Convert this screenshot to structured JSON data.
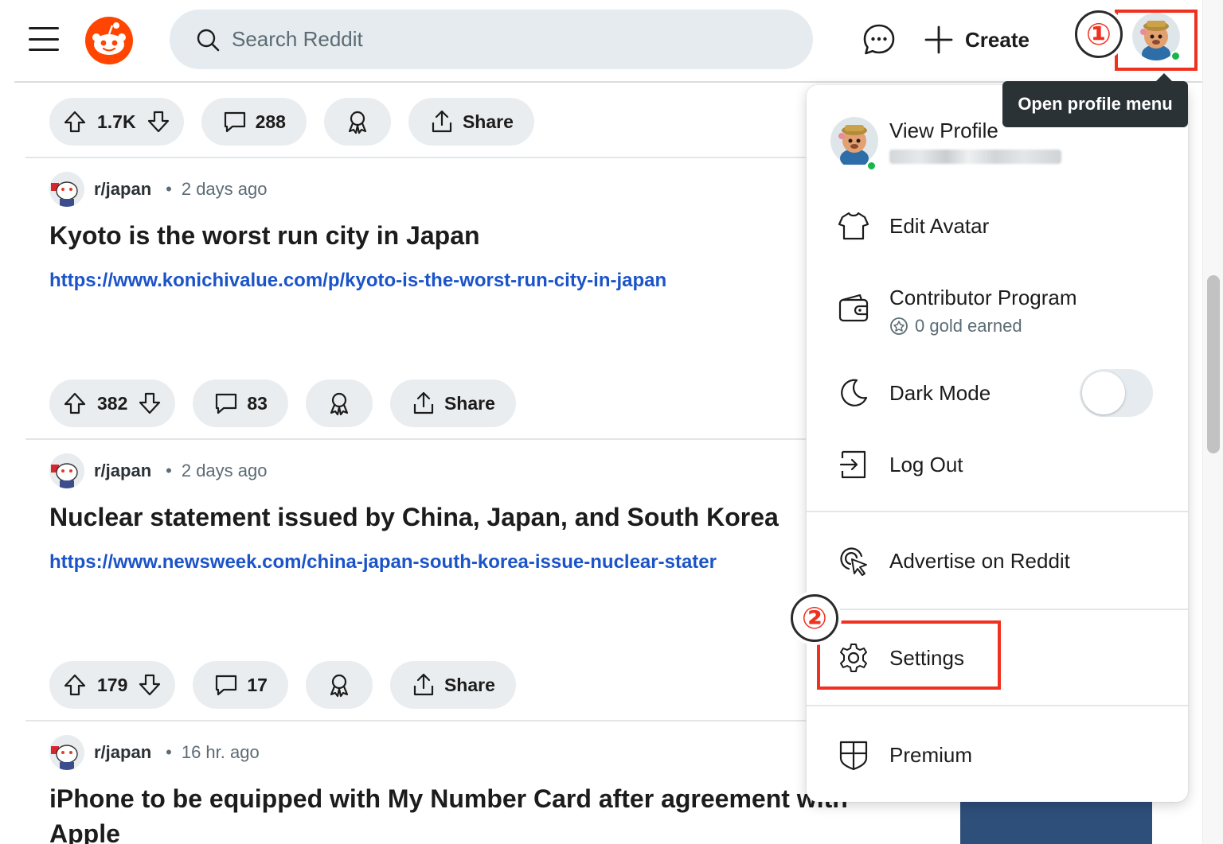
{
  "header": {
    "search_placeholder": "Search Reddit",
    "create_label": "Create",
    "avatar_tooltip": "Open profile menu"
  },
  "annotations": {
    "step1": "①",
    "step2": "②",
    "highlight_color": "#f0311f"
  },
  "posts": [
    {
      "upvotes": "1.7K",
      "comments": "288",
      "share_label": "Share"
    },
    {
      "subreddit": "r/japan",
      "separator": "•",
      "time": "2 days ago",
      "title": "Kyoto is the worst run city in Japan",
      "link": "https://www.konichivalue.com/p/kyoto-is-the-worst-run-city-in-japan",
      "upvotes": "382",
      "comments": "83",
      "share_label": "Share"
    },
    {
      "subreddit": "r/japan",
      "separator": "•",
      "time": "2 days ago",
      "title": "Nuclear statement issued by China, Japan, and South Korea",
      "link": "https://www.newsweek.com/china-japan-south-korea-issue-nuclear-stater",
      "upvotes": "179",
      "comments": "17",
      "share_label": "Share"
    },
    {
      "subreddit": "r/japan",
      "separator": "•",
      "time": "16 hr. ago",
      "title": "iPhone to be equipped with My Number Card after agreement with",
      "title_line2": "Apple"
    }
  ],
  "profile_menu": {
    "view_profile": "View Profile",
    "edit_avatar": "Edit Avatar",
    "contributor_program": "Contributor Program",
    "gold_earned": "0 gold earned",
    "dark_mode": "Dark Mode",
    "dark_mode_on": false,
    "log_out": "Log Out",
    "advertise": "Advertise on Reddit",
    "settings": "Settings",
    "premium": "Premium"
  },
  "colors": {
    "brand": "#ff4500",
    "link": "#1b54c9",
    "online": "#16b64c"
  }
}
